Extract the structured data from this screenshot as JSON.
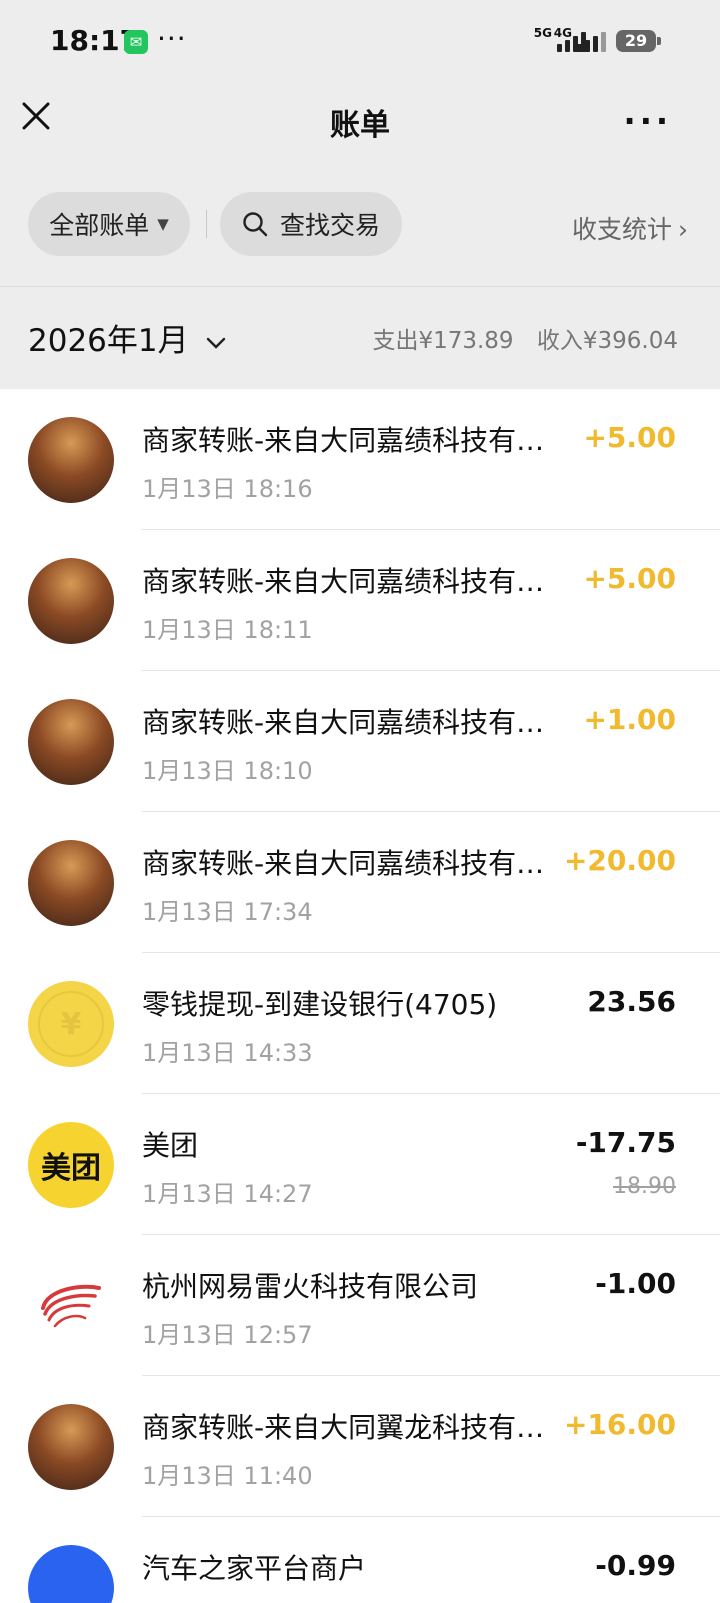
{
  "status_bar": {
    "time": "18:17",
    "dots": "···",
    "signal_5g": "5G",
    "signal_4g": "4G",
    "battery": "29",
    "wechat_icon": "wechat-icon"
  },
  "nav": {
    "title": "账单",
    "more": "···"
  },
  "filters": {
    "all_bills": "全部账单",
    "search": "查找交易",
    "stats": "收支统计"
  },
  "month": {
    "label": "2026年1月",
    "expense": "支出¥173.89",
    "income": "收入¥396.04"
  },
  "colors": {
    "positive_amount": "#f1b92d",
    "background": "#ededed",
    "coin_yellow": "#f4d548",
    "meituan_yellow": "#f7d330"
  },
  "transactions": [
    {
      "avatar": "dragon-avatar",
      "title": "商家转账-来自大同嘉绩科技有限公司",
      "time": "1月13日 18:16",
      "amount": "+5.00",
      "type": "income"
    },
    {
      "avatar": "dragon-avatar",
      "title": "商家转账-来自大同嘉绩科技有限公司",
      "time": "1月13日 18:11",
      "amount": "+5.00",
      "type": "income"
    },
    {
      "avatar": "dragon-avatar",
      "title": "商家转账-来自大同嘉绩科技有限公司",
      "time": "1月13日 18:10",
      "amount": "+1.00",
      "type": "income"
    },
    {
      "avatar": "dragon-avatar",
      "title": "商家转账-来自大同嘉绩科技有限公司",
      "time": "1月13日 17:34",
      "amount": "+20.00",
      "type": "income"
    },
    {
      "avatar": "coin-avatar",
      "avatar_text": "¥",
      "title": "零钱提现-到建设银行(4705)",
      "time": "1月13日 14:33",
      "amount": "23.56",
      "type": "neutral"
    },
    {
      "avatar": "meituan-avatar",
      "avatar_text": "美团",
      "title": "美团",
      "time": "1月13日 14:27",
      "amount": "-17.75",
      "original": "18.90",
      "type": "expense"
    },
    {
      "avatar": "netease-avatar",
      "title": "杭州网易雷火科技有限公司",
      "time": "1月13日 12:57",
      "amount": "-1.00",
      "type": "expense"
    },
    {
      "avatar": "dragon-avatar",
      "title": "商家转账-来自大同翼龙科技有限公司",
      "time": "1月13日 11:40",
      "amount": "+16.00",
      "type": "income"
    },
    {
      "avatar": "blue-avatar",
      "title": "汽车之家平台商户",
      "time": "",
      "amount": "-0.99",
      "type": "expense"
    }
  ]
}
